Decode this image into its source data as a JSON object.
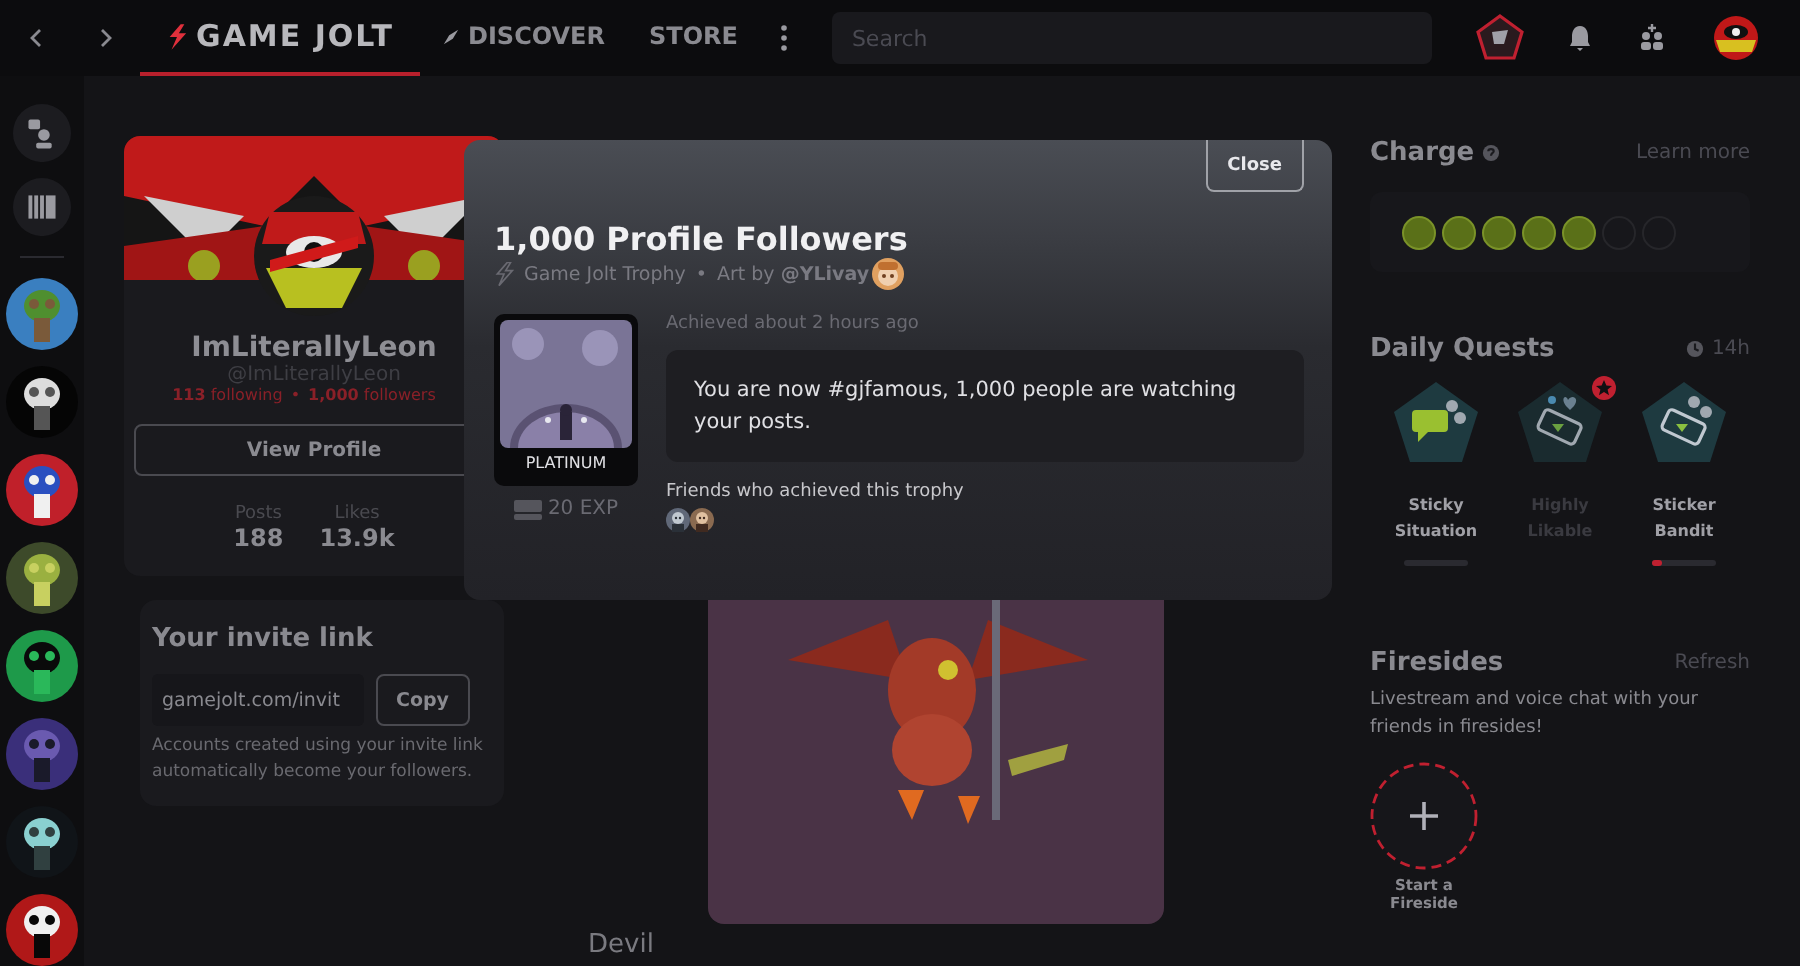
{
  "topbar": {
    "nav": [
      {
        "label": "GAME JOLT",
        "kind": "logo",
        "selected": true
      },
      {
        "label": "DISCOVER",
        "kind": "discover",
        "selected": false
      },
      {
        "label": "STORE",
        "kind": "plain",
        "selected": false
      }
    ],
    "search": {
      "placeholder": "Search"
    }
  },
  "profile": {
    "name": "ImLiterallyLeon",
    "handle": "@ImLiterallyLeon",
    "following": "**113** following",
    "separator": "•",
    "followers": "**1,000** followers",
    "button": "View Profile",
    "stats": [
      {
        "label": "Posts",
        "value": "188"
      },
      {
        "label": "Likes",
        "value": "13.9k"
      }
    ]
  },
  "invite": {
    "title": "Your invite link",
    "value": "gamejolt.com/invit",
    "button": "Copy",
    "note": "Accounts created using your invite link automatically become your followers."
  },
  "post": {
    "title": "Devil"
  },
  "charge": {
    "title": "Charge",
    "link": "Learn more",
    "orbs": [
      {
        "filled": true
      },
      {
        "filled": true
      },
      {
        "filled": true
      },
      {
        "filled": true
      },
      {
        "filled": true
      },
      {
        "filled": false
      },
      {
        "filled": false
      }
    ]
  },
  "quests": {
    "title": "Daily Quests",
    "timer": "14h",
    "items": [
      {
        "name": "Sticky Situation",
        "kind": "chat",
        "dimmed": false,
        "new": false,
        "level": 0
      },
      {
        "name": "Highly Likable",
        "kind": "like",
        "dimmed": true,
        "new": true
      },
      {
        "name": "Sticker Bandit",
        "kind": "sticker",
        "dimmed": false,
        "new": false,
        "level": 0.15
      }
    ]
  },
  "firesides": {
    "title": "Firesides",
    "link": "Refresh",
    "text": "Livestream and voice chat with your friends in firesides!",
    "start": "Start a Fireside"
  },
  "modal": {
    "title": "1,000 Profile Followers",
    "source": "Game Jolt Trophy",
    "separator": "•",
    "art": "Art by **@YLivay**",
    "close": "Close",
    "tier": "PLATINUM",
    "exp": "20 EXP",
    "achieved": "Achieved about 2 hours ago",
    "description": "You are now #gjfamous, 1,000 people are watching your posts.",
    "friends_title": "Friends who achieved this trophy"
  }
}
